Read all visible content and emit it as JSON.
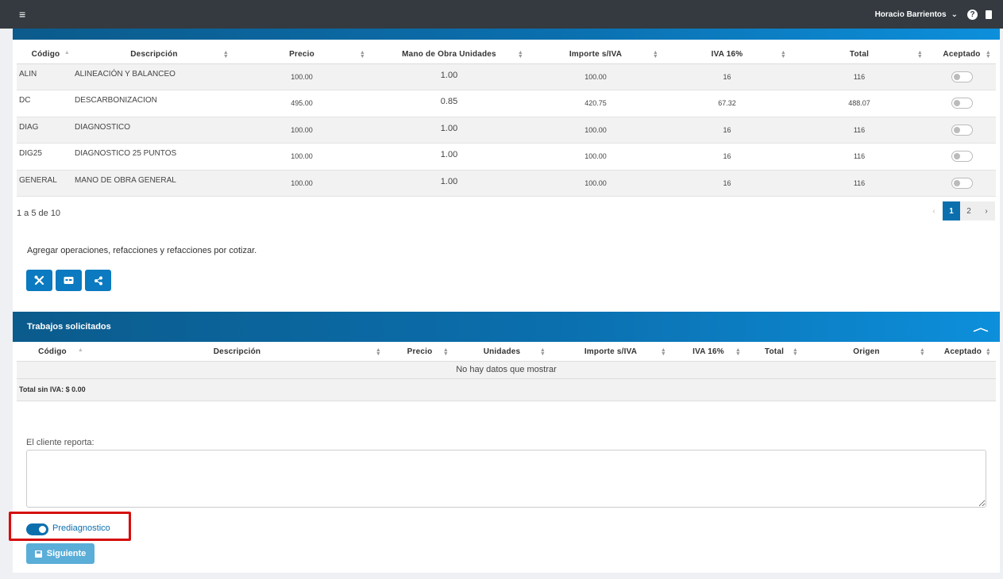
{
  "header": {
    "menu_icon": "≡",
    "user_name": "Horacio Barrientos",
    "user_caret": "⌄",
    "help_icon": "?"
  },
  "operations_table": {
    "columns": [
      "Código",
      "Descripción",
      "Precio",
      "Mano de Obra Unidades",
      "Importe s/IVA",
      "IVA 16%",
      "Total",
      "Aceptado"
    ],
    "rows": [
      {
        "code": "ALIN",
        "description": "ALINEACIÓN Y BALANCEO",
        "price": "100.00",
        "units": "1.00",
        "amount": "100.00",
        "iva": "16",
        "total": "116",
        "accepted": false
      },
      {
        "code": "DC",
        "description": "DESCARBONIZACION",
        "price": "495.00",
        "units": "0.85",
        "amount": "420.75",
        "iva": "67.32",
        "total": "488.07",
        "accepted": false
      },
      {
        "code": "DIAG",
        "description": "DIAGNOSTICO",
        "price": "100.00",
        "units": "1.00",
        "amount": "100.00",
        "iva": "16",
        "total": "116",
        "accepted": false
      },
      {
        "code": "DIG25",
        "description": "DIAGNOSTICO 25 PUNTOS",
        "price": "100.00",
        "units": "1.00",
        "amount": "100.00",
        "iva": "16",
        "total": "116",
        "accepted": false
      },
      {
        "code": "GENERAL",
        "description": "MANO DE OBRA GENERAL",
        "price": "100.00",
        "units": "1.00",
        "amount": "100.00",
        "iva": "16",
        "total": "116",
        "accepted": false
      }
    ],
    "pagination_info": "1 a 5 de 10",
    "pagination": {
      "prev": "‹",
      "pages": [
        "1",
        "2"
      ],
      "active": "1",
      "next": "›"
    }
  },
  "add_section": {
    "text": "Agregar operaciones, refacciones y refacciones por cotizar.",
    "buttons": [
      "wrench-screwdriver-icon",
      "id-card-icon",
      "share-icon"
    ]
  },
  "trabajos": {
    "title": "Trabajos solicitados",
    "columns": [
      "Código",
      "Descripción",
      "Precio",
      "Unidades",
      "Importe s/IVA",
      "IVA 16%",
      "Total",
      "Origen",
      "Aceptado"
    ],
    "empty_text": "No hay datos que mostrar",
    "total_text": "Total sin IVA: $ 0.00"
  },
  "cliente": {
    "label": "El cliente reporta:",
    "value": ""
  },
  "prediagnostico": {
    "label": "Prediagnostico",
    "enabled": true
  },
  "next_button": {
    "label": "Siguiente"
  },
  "colors": {
    "primary": "#0b6fae",
    "header_dark": "#343a40",
    "highlight_red": "#d50d0d",
    "disabled_button": "#5aaed8"
  }
}
